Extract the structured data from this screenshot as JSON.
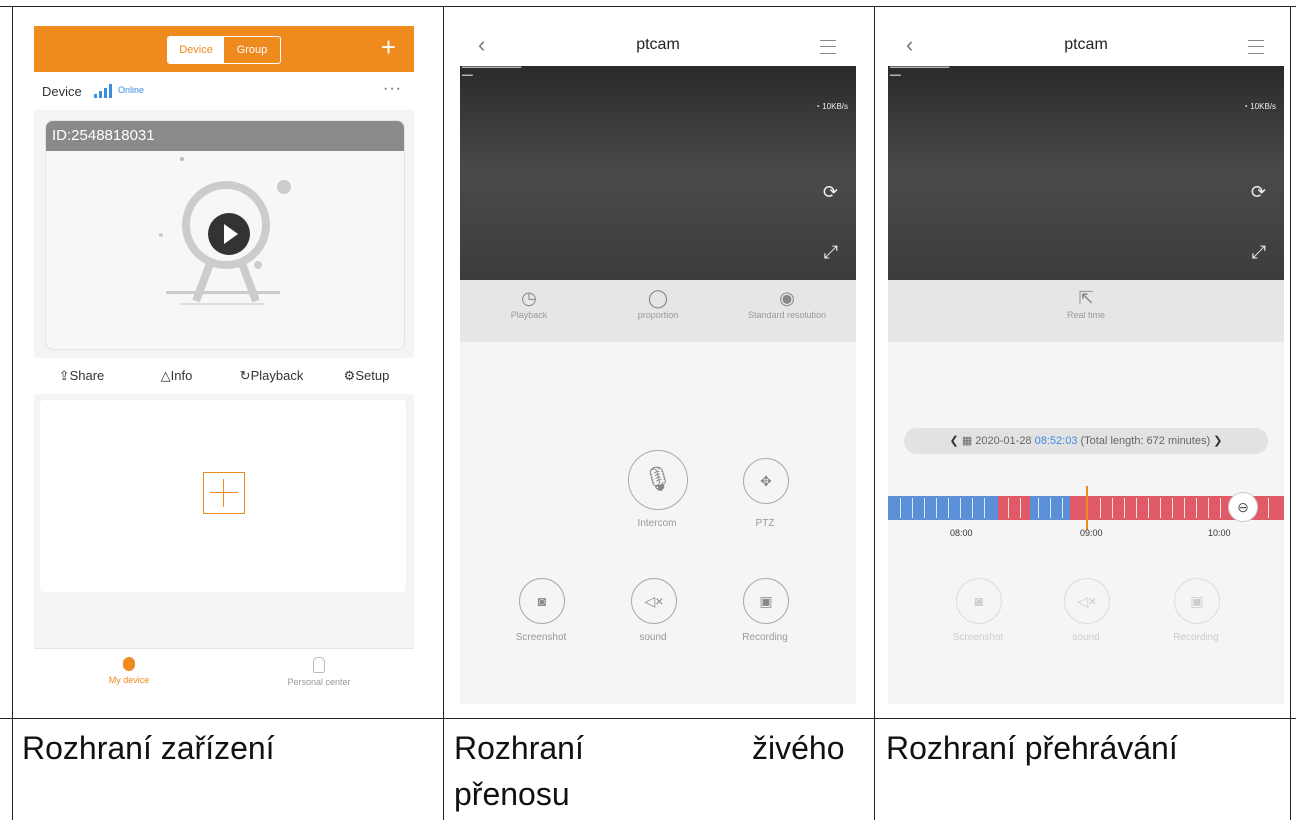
{
  "panel1": {
    "tabs": [
      "Device",
      "Group"
    ],
    "add_label": "+",
    "device_label": "Device",
    "status": "Online",
    "more": "···",
    "device_id": "ID:2548818031",
    "actions": [
      "Share",
      "Info",
      "Playback",
      "Setup"
    ],
    "bottom_tabs": [
      "My device",
      "Personal center"
    ],
    "accent": "#ef8a1e"
  },
  "panel2": {
    "title": "ptcam",
    "speed": "10KB/s",
    "controls": [
      "Playback",
      "proportion",
      "Standard resolution"
    ],
    "buttons": [
      "Intercom",
      "PTZ",
      "Screenshot",
      "sound",
      "Recording"
    ]
  },
  "panel3": {
    "title": "ptcam",
    "speed": "10KB/s",
    "control": "Real time",
    "date": "2020-01-28",
    "time": "08:52:03",
    "total": "(Total length: 672 minutes)",
    "timeline_labels": [
      "08:00",
      "09:00",
      "10:00"
    ],
    "buttons": [
      "Screenshot",
      "sound",
      "Recording"
    ]
  },
  "captions": {
    "c1": "Rozhraní zařízení",
    "c2a": "Rozhraní",
    "c2b": "živého",
    "c2c": "přenosu",
    "c3": "Rozhraní přehrávání"
  }
}
